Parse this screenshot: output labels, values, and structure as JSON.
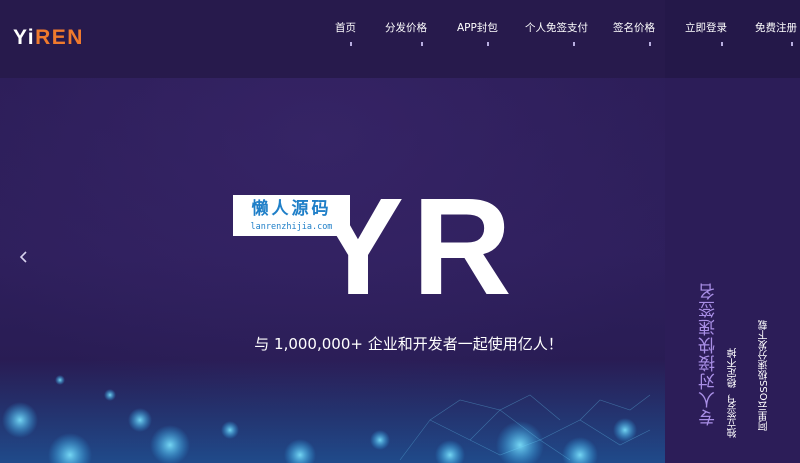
{
  "brand": {
    "logo_part1": "Yi",
    "logo_part2": "REN"
  },
  "nav": {
    "items": [
      {
        "label": "首页"
      },
      {
        "label": "分发价格"
      },
      {
        "label": "APP封包"
      },
      {
        "label": "个人免签支付"
      },
      {
        "label": "签名价格"
      },
      {
        "label": "立即登录"
      },
      {
        "label": "免费注册"
      }
    ]
  },
  "hero": {
    "big_text": "YR",
    "tagline": "与 1,000,000+ 企业和开发者一起使用亿人！",
    "prev_icon": "chevron-left-icon"
  },
  "watermark": {
    "title": "懒人源码",
    "url": "lanrenzhijia.com"
  },
  "sidebar": {
    "title": "专人对接快速签名",
    "line1": "独立签名，稳定不掉",
    "line2": "阿里云OSS极速分发下载"
  },
  "colors": {
    "accent": "#f07a2d",
    "background": "#2b1b52",
    "sidebar_title": "#a98fe6"
  }
}
